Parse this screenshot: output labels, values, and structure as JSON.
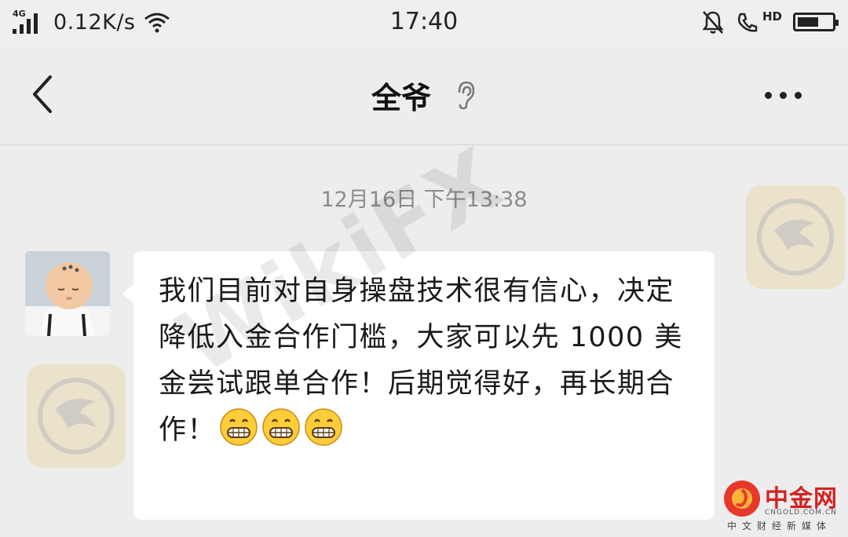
{
  "status_bar": {
    "network": "4G",
    "speed": "0.12K/s",
    "time": "17:40",
    "hd": "HD",
    "battery_level": 0.62
  },
  "nav": {
    "title": "全爷",
    "icons": [
      "back-chevron-icon",
      "ear-icon",
      "more-dots-icon"
    ]
  },
  "chat": {
    "timestamp": "12月16日 下午13:38",
    "message": "我们目前对自身操盘技术很有信心，决定降低入金合作门槛，大家可以先 1000 美金尝试跟单合作！后期觉得好，再长期合作！",
    "emoji": [
      "grinning-face",
      "grinning-face",
      "grinning-face"
    ]
  },
  "watermark": {
    "text": "WikiFX"
  },
  "brand": {
    "name": "中金网",
    "url": "CNGOLD.COM.CN",
    "tagline": "中文财经新媒体",
    "color": "#d32222"
  }
}
